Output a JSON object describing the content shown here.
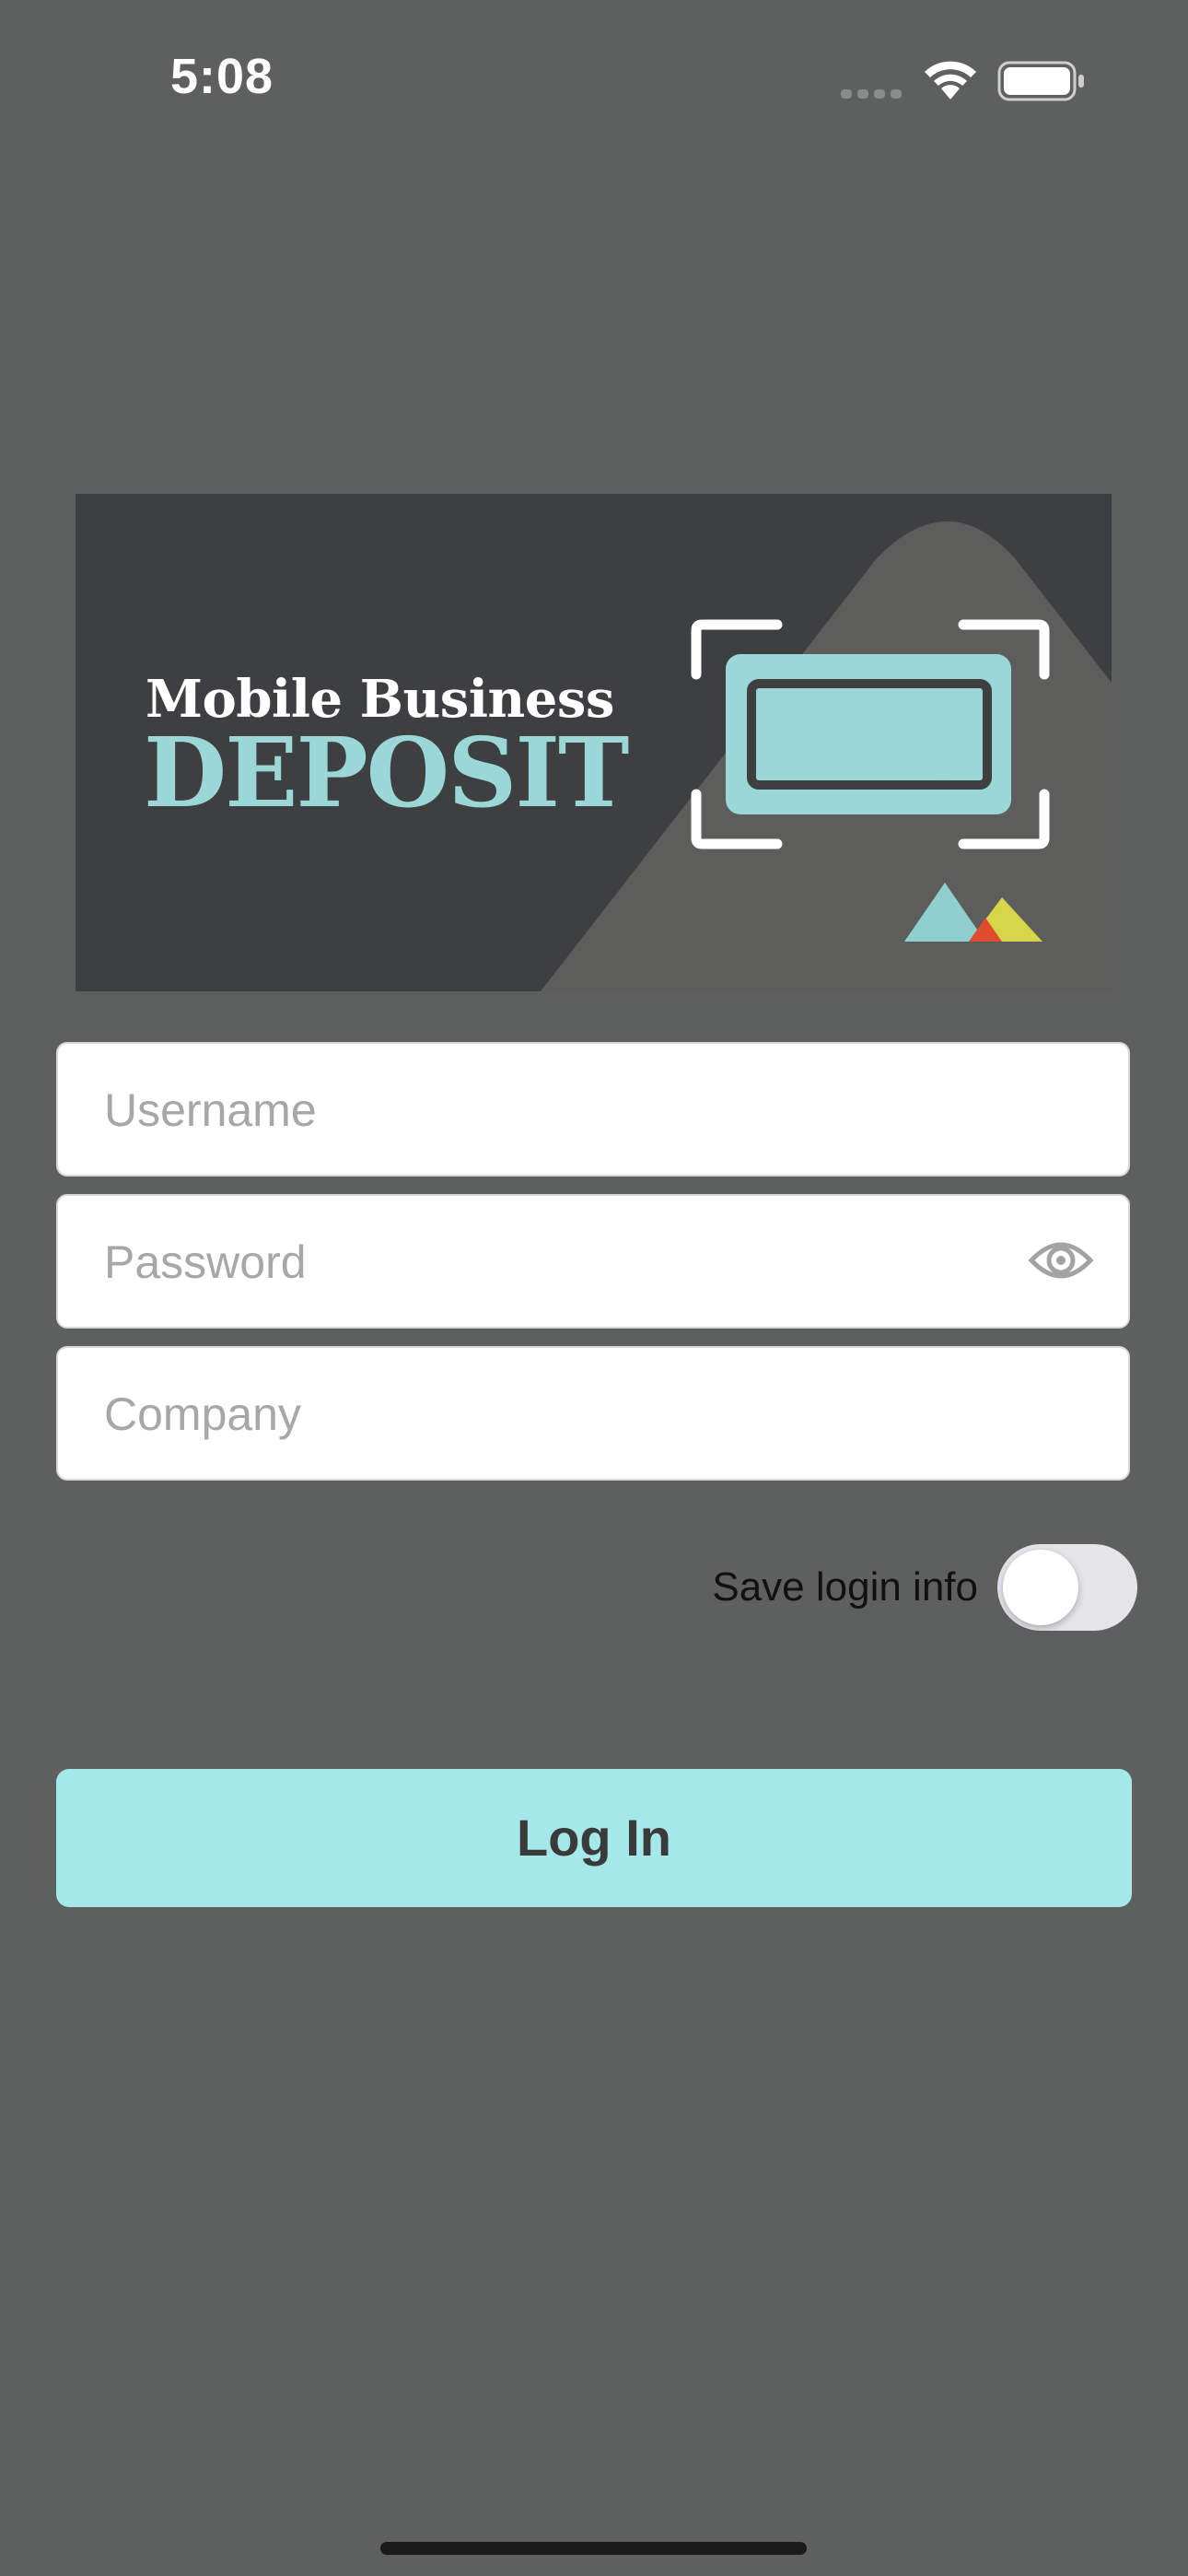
{
  "status_bar": {
    "time": "5:08",
    "icons": [
      "signal-icon",
      "wifi-icon",
      "battery-icon"
    ]
  },
  "banner": {
    "title_line1": "Mobile Business",
    "title_line2": "DEPOSIT",
    "icons": [
      "check-scan-icon",
      "mountain-logo-icon"
    ],
    "colors": {
      "background": "#3e3f41",
      "mountain": "#5d5e5c",
      "accent": "#9ad7d6",
      "logo_teal": "#8fd0cf",
      "logo_red": "#e04a2f",
      "logo_yellow": "#d7d54a"
    }
  },
  "form": {
    "username_placeholder": "Username",
    "password_placeholder": "Password",
    "company_placeholder": "Company",
    "password_visibility_icon": "eye-icon",
    "save_login_label": "Save login info",
    "save_login_enabled": false,
    "login_button_label": "Log In"
  },
  "colors": {
    "page_background": "#5e5f5f",
    "button_background": "#a5e8e9",
    "button_text": "#3a3a3a"
  }
}
